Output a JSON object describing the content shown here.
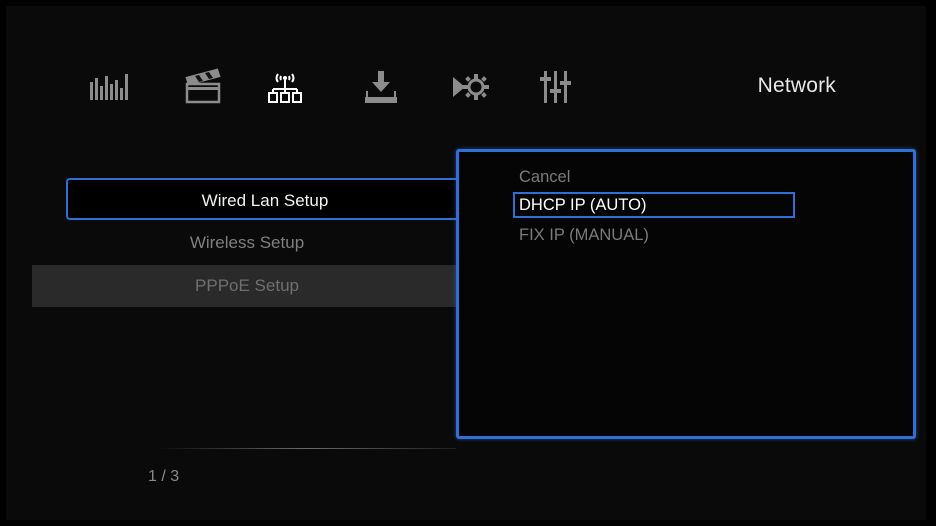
{
  "header": {
    "title": "Network",
    "tabs": [
      {
        "icon": "equalizer-icon",
        "active": false
      },
      {
        "icon": "clapperboard-icon",
        "active": false
      },
      {
        "icon": "network-icon",
        "active": true
      },
      {
        "icon": "download-icon",
        "active": false
      },
      {
        "icon": "gear-arrow-icon",
        "active": false
      },
      {
        "icon": "sliders-icon",
        "active": false
      }
    ]
  },
  "menu": {
    "items": [
      {
        "label": "Wired Lan Setup",
        "state": "selected"
      },
      {
        "label": "Wireless Setup",
        "state": "normal"
      },
      {
        "label": "PPPoE Setup",
        "state": "disabled"
      }
    ]
  },
  "popup": {
    "options": [
      {
        "label": "Cancel",
        "state": "normal"
      },
      {
        "label": "DHCP IP (AUTO)",
        "state": "highlighted"
      },
      {
        "label": "FIX IP (MANUAL)",
        "state": "normal"
      }
    ]
  },
  "footer": {
    "page_counter": "1 / 3"
  },
  "colors": {
    "accent": "#2f6fd6",
    "background": "#0a0a0a",
    "text_active": "#f2f2f2",
    "text_inactive": "#7f7f7f"
  }
}
